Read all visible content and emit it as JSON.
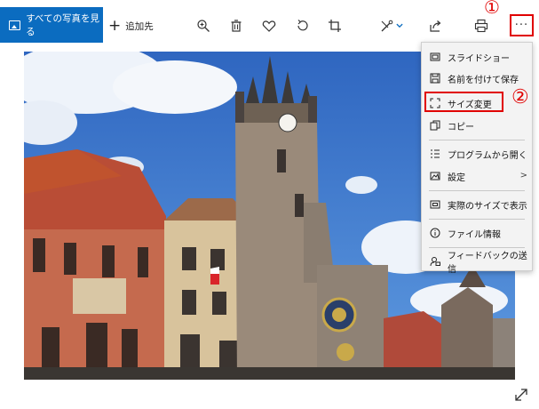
{
  "toolbar": {
    "all_photos_label": "すべての写真を見る",
    "add_label": "追加先",
    "more_label": "···",
    "icons": [
      "zoom-in-icon",
      "delete-icon",
      "heart-icon",
      "rotate-icon",
      "crop-icon",
      "edit-draw-icon",
      "share-icon",
      "print-icon",
      "more-icon"
    ],
    "accent": "#0b6cc0"
  },
  "annotations": {
    "callout_1": "①",
    "callout_2": "②",
    "color": "#e00000"
  },
  "menu": {
    "items": [
      {
        "label": "スライドショー",
        "icon": "slideshow-icon"
      },
      {
        "label": "名前を付けて保存",
        "icon": "save-icon"
      },
      {
        "label": "サイズ変更",
        "icon": "resize-icon",
        "highlighted": true
      },
      {
        "label": "コピー",
        "icon": "copy-icon"
      },
      {
        "label": "プログラムから開く",
        "icon": "open-with-icon"
      },
      {
        "label": "設定",
        "icon": "settings-image-icon",
        "submenu": ">"
      },
      {
        "label": "実際のサイズで表示",
        "icon": "actual-size-icon"
      },
      {
        "label": "ファイル情報",
        "icon": "info-icon"
      },
      {
        "label": "フィードバックの送信",
        "icon": "feedback-icon"
      }
    ]
  },
  "photo": {
    "subject": "prague-old-town-hall-clock-tower"
  }
}
